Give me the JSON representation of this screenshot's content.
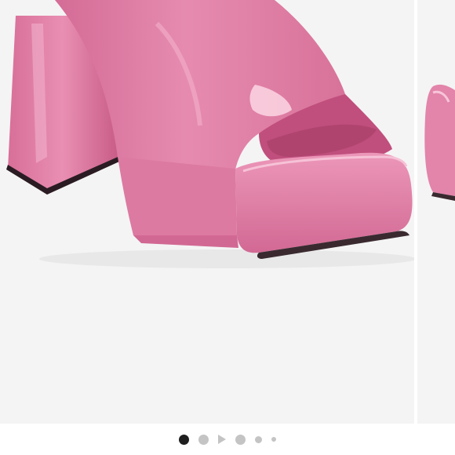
{
  "carousel": {
    "current_index": 0,
    "indicators": [
      {
        "type": "image",
        "state": "active",
        "size": "md"
      },
      {
        "type": "image",
        "state": "inactive",
        "size": "md"
      },
      {
        "type": "video",
        "state": "inactive",
        "icon": "play-icon"
      },
      {
        "type": "image",
        "state": "inactive",
        "size": "md"
      },
      {
        "type": "image",
        "state": "inactive",
        "size": "sm"
      },
      {
        "type": "image",
        "state": "inactive",
        "size": "xs"
      }
    ]
  },
  "colors": {
    "shoe_pink": "#e07ba3",
    "shoe_pink_dark": "#c25a85",
    "shoe_highlight": "#f6c0d4",
    "background": "#f4f4f4",
    "sole_line": "#3a2a30",
    "indicator_active": "#1f1f1f",
    "indicator_inactive": "#c4c4c4"
  }
}
